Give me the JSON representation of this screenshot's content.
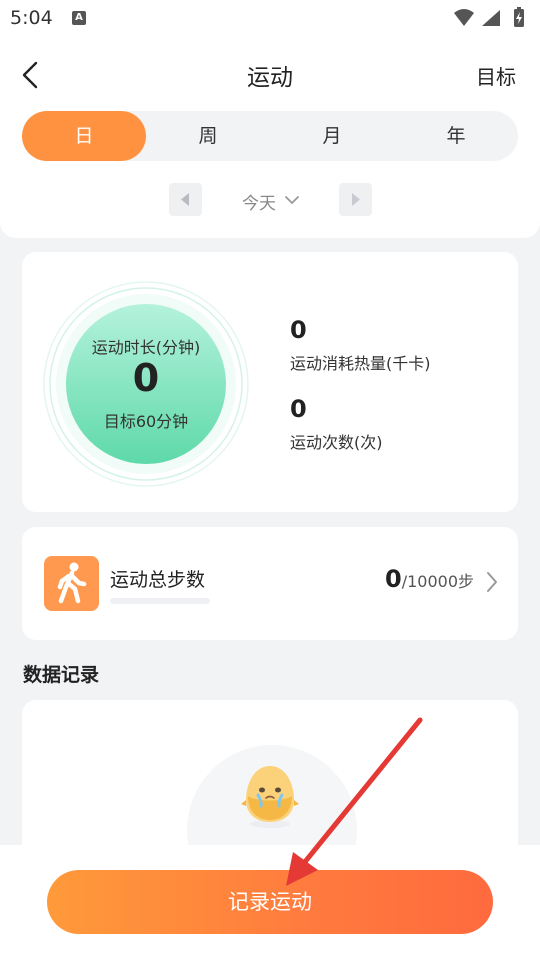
{
  "status_bar": {
    "time": "5:04",
    "notification_icon": "A",
    "icons": [
      "wifi-icon",
      "signal-icon",
      "battery-charging-icon"
    ]
  },
  "header": {
    "back_icon": "chevron-left-icon",
    "title": "运动",
    "goal_link": "目标"
  },
  "period_tabs": [
    {
      "label": "日",
      "active": true
    },
    {
      "label": "周",
      "active": false
    },
    {
      "label": "月",
      "active": false
    },
    {
      "label": "年",
      "active": false
    }
  ],
  "date_nav": {
    "label": "今天",
    "prev_icon": "triangle-left-icon",
    "next_icon": "triangle-right-icon",
    "dropdown_icon": "chevron-down-icon"
  },
  "summary": {
    "duration_label": "运动时长(分钟)",
    "duration_value": "0",
    "goal_text": "目标60分钟",
    "calories_value": "0",
    "calories_label": "运动消耗热量(千卡)",
    "count_value": "0",
    "count_label": "运动次数(次)",
    "ring_progress": 0,
    "colors": {
      "ring_start": "#a8f0d5",
      "ring_end": "#6ee0b4"
    }
  },
  "steps": {
    "icon": "walking-person-icon",
    "title": "运动总步数",
    "value": "0",
    "target": "/10000步",
    "progress": 0
  },
  "records": {
    "section_title": "数据记录",
    "empty_icon": "egg-mascot-icon"
  },
  "record_button": {
    "label": "记录运动"
  },
  "colors": {
    "accent": "#ff9240",
    "annotation_arrow": "#e53935"
  }
}
